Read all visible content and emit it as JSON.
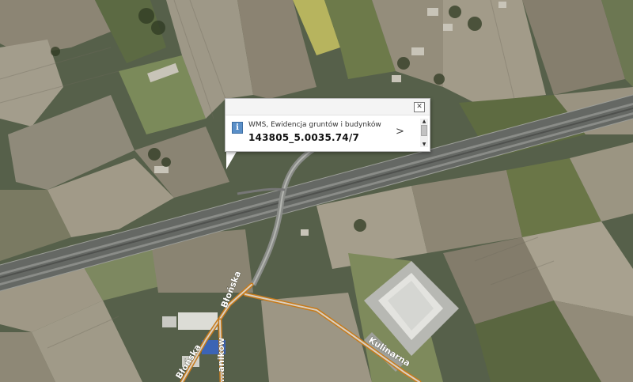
{
  "map": {
    "basemap": "aerial-orthophoto",
    "road_labels": {
      "bluska_upper": "Błońska",
      "bluska_lower": "Błońska",
      "kulinarna": "Kulinarna",
      "lower_street": "...anikow"
    },
    "colors": {
      "road_outline": "#c77b1c",
      "road_fill": "#d9d0c2",
      "highway": "#6b6d6a"
    }
  },
  "popup": {
    "layer_name": "WMS, Ewidencja gruntów i budynków",
    "parcel_id": "143805_5.0035.74/7",
    "close_icon": "close-icon",
    "info_icon_glyph": "i",
    "next_glyph": ">",
    "scroll_up_glyph": "▲",
    "scroll_down_glyph": "▼"
  }
}
